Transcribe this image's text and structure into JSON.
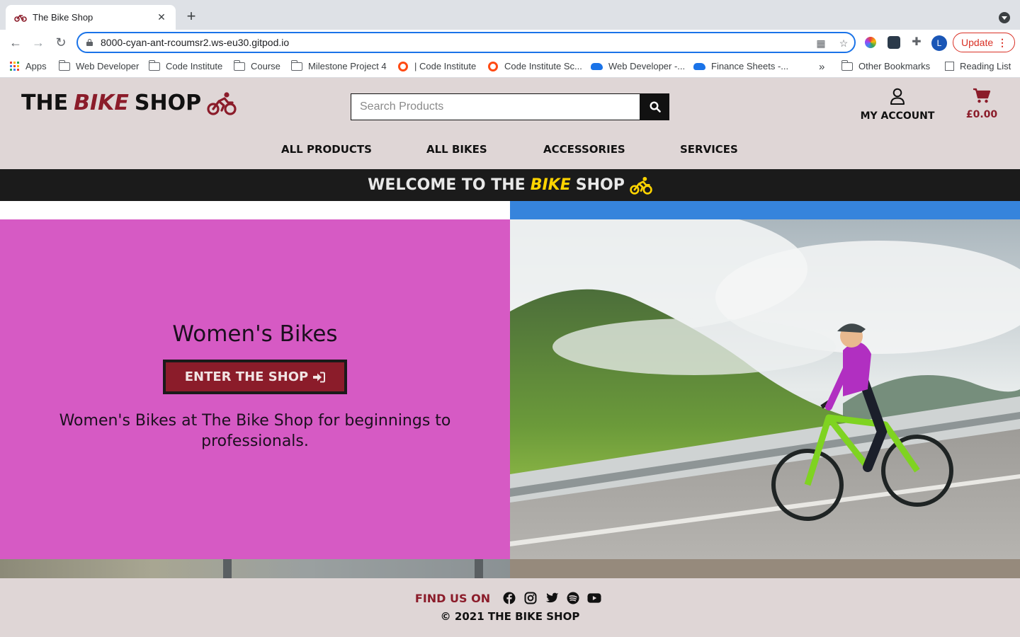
{
  "browser": {
    "tab_title": "The Bike Shop",
    "url": "8000-cyan-ant-rcoumsr2.ws-eu30.gitpod.io",
    "profile_initial": "L",
    "update_label": "Update",
    "bookmarks": [
      "Apps",
      "Web Developer",
      "Code Institute",
      "Course",
      "Milestone Project 4",
      "| Code Institute",
      "Code Institute Sc...",
      "Web Developer -...",
      "Finance Sheets -..."
    ],
    "overflow_label": "»",
    "other_bookmarks": "Other Bookmarks",
    "reading_list": "Reading List"
  },
  "header": {
    "logo": {
      "part1": "THE",
      "part2": "BIKE",
      "part3": "SHOP"
    },
    "search_placeholder": "Search Products",
    "account_label": "MY ACCOUNT",
    "cart_total": "£0.00"
  },
  "nav": {
    "items": [
      "ALL PRODUCTS",
      "ALL BIKES",
      "ACCESSORIES",
      "SERVICES"
    ]
  },
  "banner": {
    "part1": "WELCOME TO THE",
    "part2": "BIKE",
    "part3": "SHOP"
  },
  "hero": {
    "title": "Women's Bikes",
    "button_label": "ENTER THE SHOP",
    "description": "Women's Bikes at The Bike Shop for beginnings to professionals."
  },
  "footer": {
    "find_us": "FIND US ON",
    "social": [
      "facebook-icon",
      "instagram-icon",
      "twitter-icon",
      "spotify-icon",
      "youtube-icon"
    ],
    "copyright": "© 2021 THE BIKE SHOP"
  },
  "colors": {
    "brand_red": "#8b1c2a",
    "banner_yellow": "#ffd400",
    "hero_pink": "#d65ac4",
    "header_bg": "#dfd6d6"
  }
}
